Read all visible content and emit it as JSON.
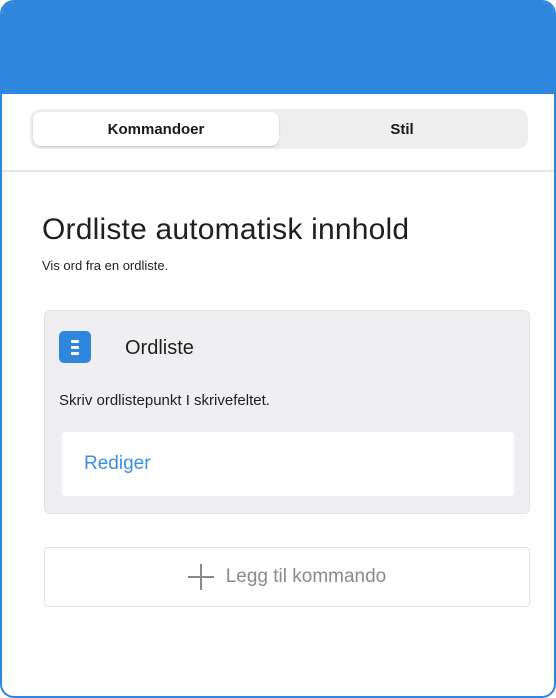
{
  "colors": {
    "accent": "#2f86dd",
    "link": "#3a8fe0"
  },
  "tabs": {
    "items": [
      {
        "label": "Kommandoer",
        "active": true
      },
      {
        "label": "Stil",
        "active": false
      }
    ]
  },
  "page": {
    "title": "Ordliste automatisk innhold",
    "subtitle": "Vis ord fra en ordliste."
  },
  "card": {
    "icon": "list-icon",
    "title": "Ordliste",
    "description": "Skriv ordlistepunkt I skrivefeltet.",
    "edit_label": "Rediger"
  },
  "add_command": {
    "icon": "plus-icon",
    "label": "Legg til kommando"
  }
}
